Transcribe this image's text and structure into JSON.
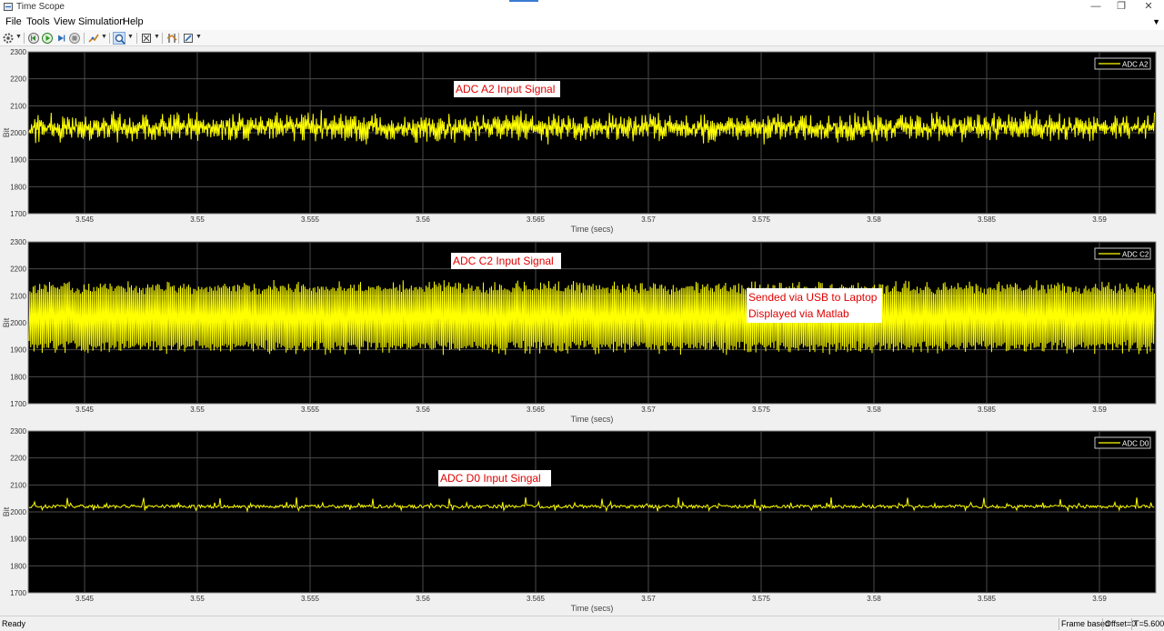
{
  "window": {
    "title": "Time Scope",
    "controls": [
      "—",
      "❐",
      "✕"
    ]
  },
  "menu": {
    "items": [
      "File",
      "Tools",
      "View",
      "Simulation",
      "Help"
    ]
  },
  "toolbar": {
    "icons": [
      "gear-icon",
      "step-back-icon",
      "run-icon",
      "step-forward-icon",
      "stop-icon",
      "highlight-icon",
      "zoom-in-icon",
      "autoscale-icon",
      "cursor-measurements-icon",
      "style-icon"
    ]
  },
  "plot_common": {
    "yticks": [
      "2300",
      "2200",
      "2100",
      "2000",
      "1900",
      "1800",
      "1700"
    ],
    "xticks": [
      "3.545",
      "3.55",
      "3.555",
      "3.56",
      "3.565",
      "3.57",
      "3.575",
      "3.58",
      "3.585",
      "3.59"
    ],
    "xlabel": "Time (secs)",
    "ylabel": "Bit"
  },
  "annotations": {
    "a2": "ADC A2 Input Signal",
    "c2": "ADC C2 Input Signal",
    "d0": "ADC D0 Input Singal",
    "usb_line1": "Sended via USB to Laptop",
    "usb_line2": "Displayed via Matlab"
  },
  "status": {
    "left": "Ready",
    "frame": "Frame based",
    "offset": "Offset=0",
    "time": "T=5.600"
  },
  "colors": {
    "plot_background": "#000000",
    "signal": "#ffff00",
    "grid": "#4a4a4a",
    "annotation_text": "#e00000"
  },
  "chart_data": [
    {
      "type": "line",
      "title": "",
      "series": [
        {
          "name": "ADC A2",
          "mean": 2020,
          "amplitude": 60
        }
      ],
      "x_range": [
        3.5425,
        3.5925
      ],
      "ylim": [
        1700,
        2300
      ],
      "xlabel": "Time (secs)",
      "ylabel": "Bit",
      "grid": true,
      "legend": "top-right"
    },
    {
      "type": "line",
      "title": "",
      "series": [
        {
          "name": "ADC C2",
          "mean": 2020,
          "amplitude": 140
        }
      ],
      "x_range": [
        3.5425,
        3.5925
      ],
      "ylim": [
        1700,
        2300
      ],
      "xlabel": "Time (secs)",
      "ylabel": "Bit",
      "grid": true,
      "legend": "top-right"
    },
    {
      "type": "line",
      "title": "",
      "series": [
        {
          "name": "ADC D0",
          "mean": 2020,
          "amplitude": 6,
          "spike_peak": 2055
        }
      ],
      "x_range": [
        3.5425,
        3.5925
      ],
      "ylim": [
        1700,
        2300
      ],
      "xlabel": "Time (secs)",
      "ylabel": "Bit",
      "grid": true,
      "legend": "top-right"
    }
  ]
}
